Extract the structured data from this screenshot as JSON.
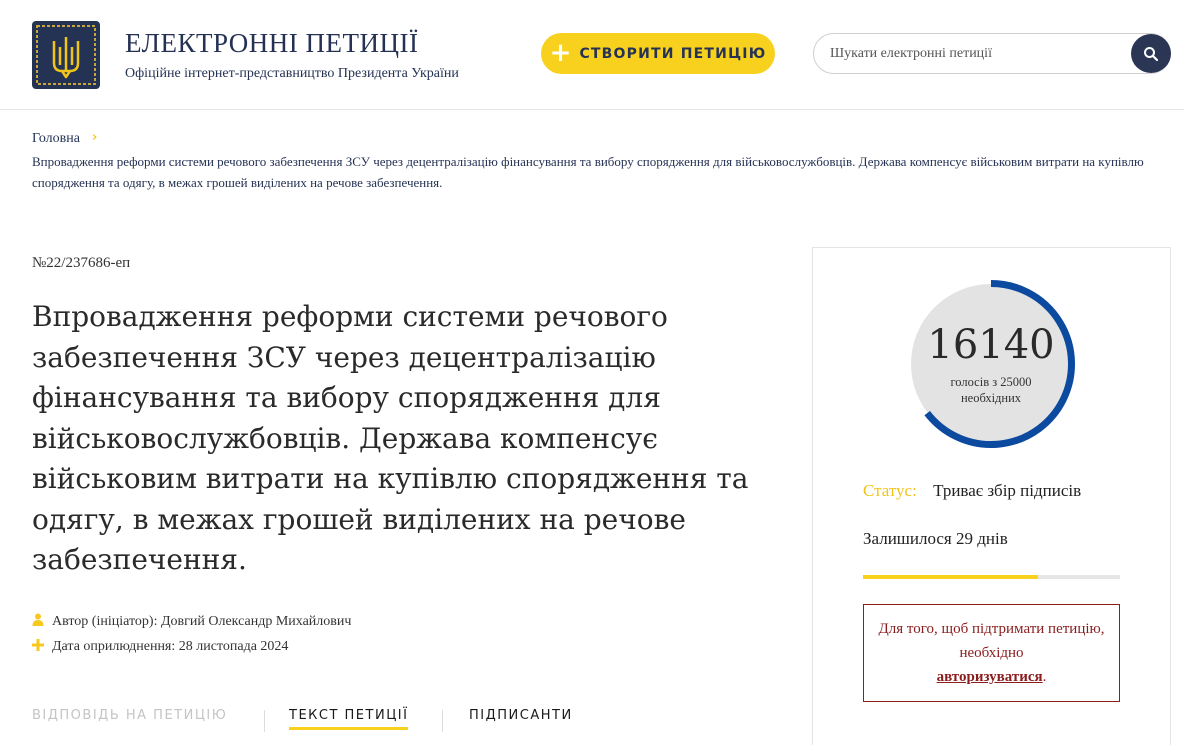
{
  "header": {
    "site_title": "ЕЛЕКТРОННІ ПЕТИЦІЇ",
    "site_subtitle": "Офіційне інтернет-представництво Президента України",
    "create_button_label": "СТВОРИТИ ПЕТИЦІЮ",
    "search_placeholder": "Шукати електронні петиції"
  },
  "breadcrumb": {
    "home": "Головна",
    "separator": "›",
    "current": "Впровадження реформи системи речового забезпечення ЗСУ через децентралізацію фінансування та вибору спорядження для військовослужбовців. Держава компенсує військовим витрати на купівлю спорядження та одягу, в межах грошей виділених на речове забезпечення."
  },
  "petition": {
    "number": "№22/237686-еп",
    "title": "Впровадження реформи системи речового забезпечення ЗСУ через децентралізацію фінансування та вибору спорядження для військовослужбовців. Держава компенсує військовим витрати на купівлю спорядження та одягу, в межах грошей виділених на речове забезпечення.",
    "author": "Автор (ініціатор): Довгий Олександр Михайлович",
    "published": "Дата оприлюднення: 28 листопада 2024"
  },
  "tabs": [
    {
      "label": "ВІДПОВІДЬ НА ПЕТИЦІЮ",
      "active": false,
      "disabled": true
    },
    {
      "label": "ТЕКСТ ПЕТИЦІЇ",
      "active": true,
      "disabled": false
    },
    {
      "label": "ПІДПИСАНТИ",
      "active": false,
      "disabled": false
    }
  ],
  "panel": {
    "votes": "16140",
    "votes_caption": "голосів з 25000 необхідних",
    "votes_count": 16140,
    "votes_needed": 25000,
    "status_label": "Статус:",
    "status_value": "Триває збір підписів",
    "remaining": "Залишилося 29 днів",
    "time_progress_fraction": 0.68,
    "auth_text_before": "Для того, щоб підтримати петицію, необхідно",
    "auth_link": "авторизуватися",
    "auth_text_after": "."
  },
  "colors": {
    "accent_yellow": "#f8d11e",
    "navy": "#253254",
    "gauge_blue": "#0b4a9e",
    "gauge_track": "#e3e3e3",
    "auth_red": "#8a1d1d"
  },
  "icons": {
    "logo": "trident-emblem-icon",
    "create": "plus-icon",
    "search": "search-icon",
    "author": "user-icon",
    "date": "plus-icon"
  }
}
